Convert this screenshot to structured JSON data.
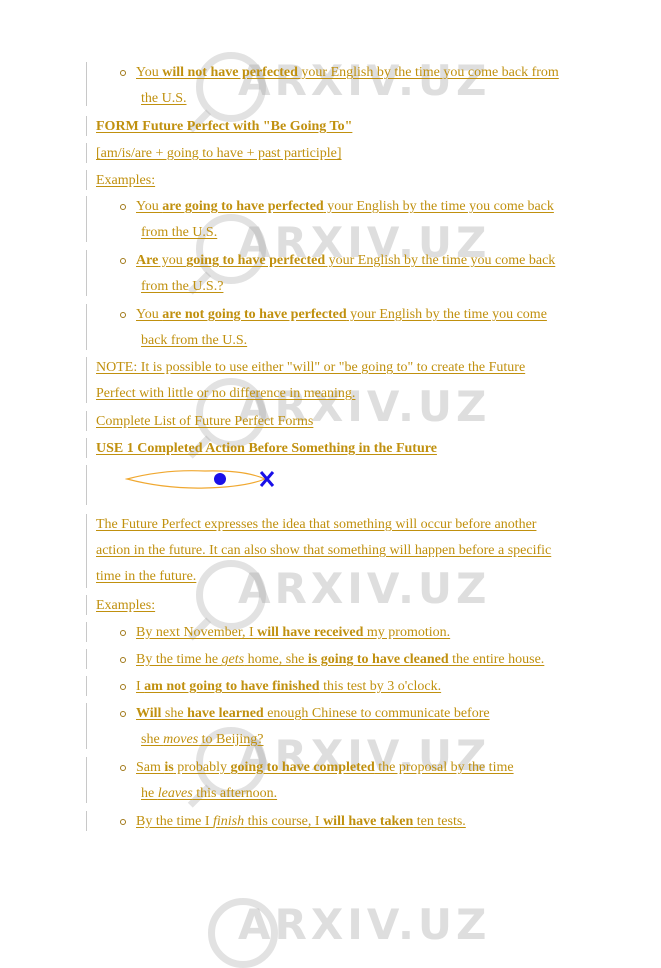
{
  "watermark": {
    "text": "ARXIV.UZ"
  },
  "colors": {
    "text": "#c0900e",
    "border": "#c8c8c8",
    "timeline_ellipse": "#f0a830",
    "timeline_marks": "#1a10e8"
  },
  "section_prev_examples": {
    "item_neg": {
      "l1": {
        "a": "You ",
        "b": "will not have perfected",
        "c": " your English by the time you come back from"
      },
      "l2": "the U.S."
    }
  },
  "form_heading": "FORM Future Perfect with \"Be Going To\"",
  "form_formula": "[am/is/are + going to have + past participle]",
  "examples_label_1": "Examples:",
  "examples_1": [
    {
      "l1": {
        "a": "You ",
        "b": "are going to have perfected",
        "c": " your English by the time you come back "
      },
      "l2": "from the U.S."
    },
    {
      "l1": {
        "a": "Are",
        "b2": " you ",
        "b": "going to have perfected",
        "c": " your English by the time you come back "
      },
      "l2": "from the U.S.?"
    },
    {
      "l1": {
        "a": "You ",
        "b": "are not going to have perfected",
        "c": " your English by the time you come "
      },
      "l2": "back from the U.S."
    }
  ],
  "note": {
    "l1": "NOTE: It is possible to use either \"will\" or \"be going to\" to create the Future ",
    "l2": "Perfect with little or no difference in meaning."
  },
  "complete_list_link": "Complete List of Future Perfect Forms",
  "use1_heading": "USE 1 Completed Action Before Something in the Future",
  "use1_description": {
    "l1": "The Future Perfect expresses the idea that something will occur before another ",
    "l2": "action in the future. It can also show that something will happen before a specific ",
    "l3": "time in the future."
  },
  "examples_label_2": "Examples:",
  "examples_2": {
    "e1": {
      "a": "By next November, I ",
      "b": "will have received",
      "c": " my promotion."
    },
    "e2": {
      "a": "By the time he ",
      "i": "gets",
      "b0": " home, she ",
      "b": "is going to have cleaned",
      "c": " the entire house."
    },
    "e3": {
      "a": "I ",
      "b": "am not going to have finished",
      "c": " this test by 3 o'clock."
    },
    "e4": {
      "b1": "Will",
      "a": " she ",
      "b": "have learned",
      "c": " enough Chinese to communicate before ",
      "l2a": "she ",
      "l2i": "moves",
      "l2c": " to Beijing?"
    },
    "e5": {
      "a": "Sam ",
      "b1": "is",
      "a2": " probably ",
      "b": "going to have completed",
      "c": " the proposal by the time ",
      "l2a": "he ",
      "l2i": "leaves",
      "l2c": " this afternoon."
    },
    "e6": {
      "a": "By the time I ",
      "i": "finish",
      "a2": " this course, I ",
      "b": "will have taken",
      "c": " ten tests."
    }
  }
}
